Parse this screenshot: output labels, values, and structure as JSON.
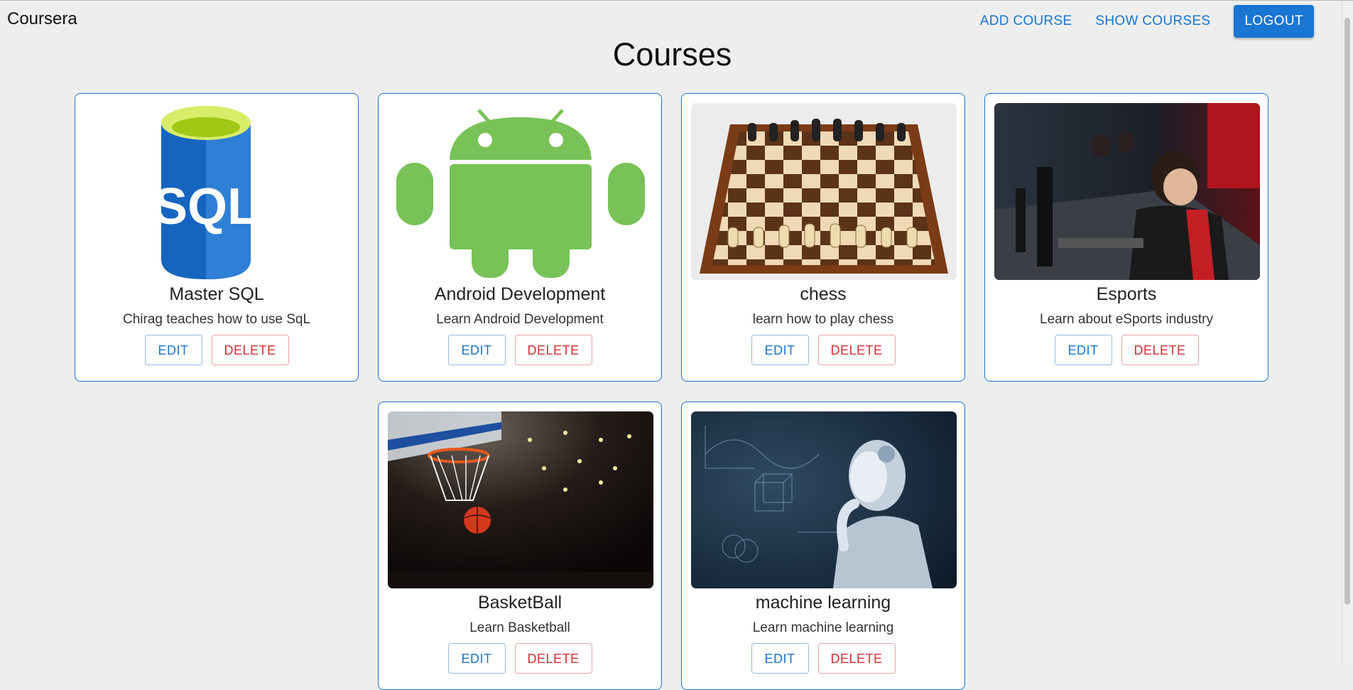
{
  "header": {
    "brand": "Coursera",
    "nav": {
      "add_course": "ADD COURSE",
      "show_courses": "SHOW COURSES",
      "logout": "LOGOUT"
    }
  },
  "page": {
    "title": "Courses"
  },
  "courses": [
    {
      "title": "Master SQL",
      "description": "Chirag teaches how to use SqL",
      "image": "sql-database-icon",
      "edit": "EDIT",
      "delete": "DELETE"
    },
    {
      "title": "Android Development",
      "description": "Learn Android Development",
      "image": "android-robot-icon",
      "edit": "EDIT",
      "delete": "DELETE"
    },
    {
      "title": "chess",
      "description": "learn how to play chess",
      "image": "chess-board-photo",
      "edit": "EDIT",
      "delete": "DELETE"
    },
    {
      "title": "Esports",
      "description": "Learn about eSports industry",
      "image": "esports-players-photo",
      "edit": "EDIT",
      "delete": "DELETE"
    },
    {
      "title": "BasketBall",
      "description": "Learn Basketball",
      "image": "basketball-hoop-photo",
      "edit": "EDIT",
      "delete": "DELETE"
    },
    {
      "title": "machine learning",
      "description": "Learn machine learning",
      "image": "robot-thinking-photo",
      "edit": "EDIT",
      "delete": "DELETE"
    }
  ],
  "colors": {
    "primary": "#1976d2",
    "danger": "#d32f2f",
    "background": "#eeeeee"
  },
  "sql_logo_text": "SQL"
}
